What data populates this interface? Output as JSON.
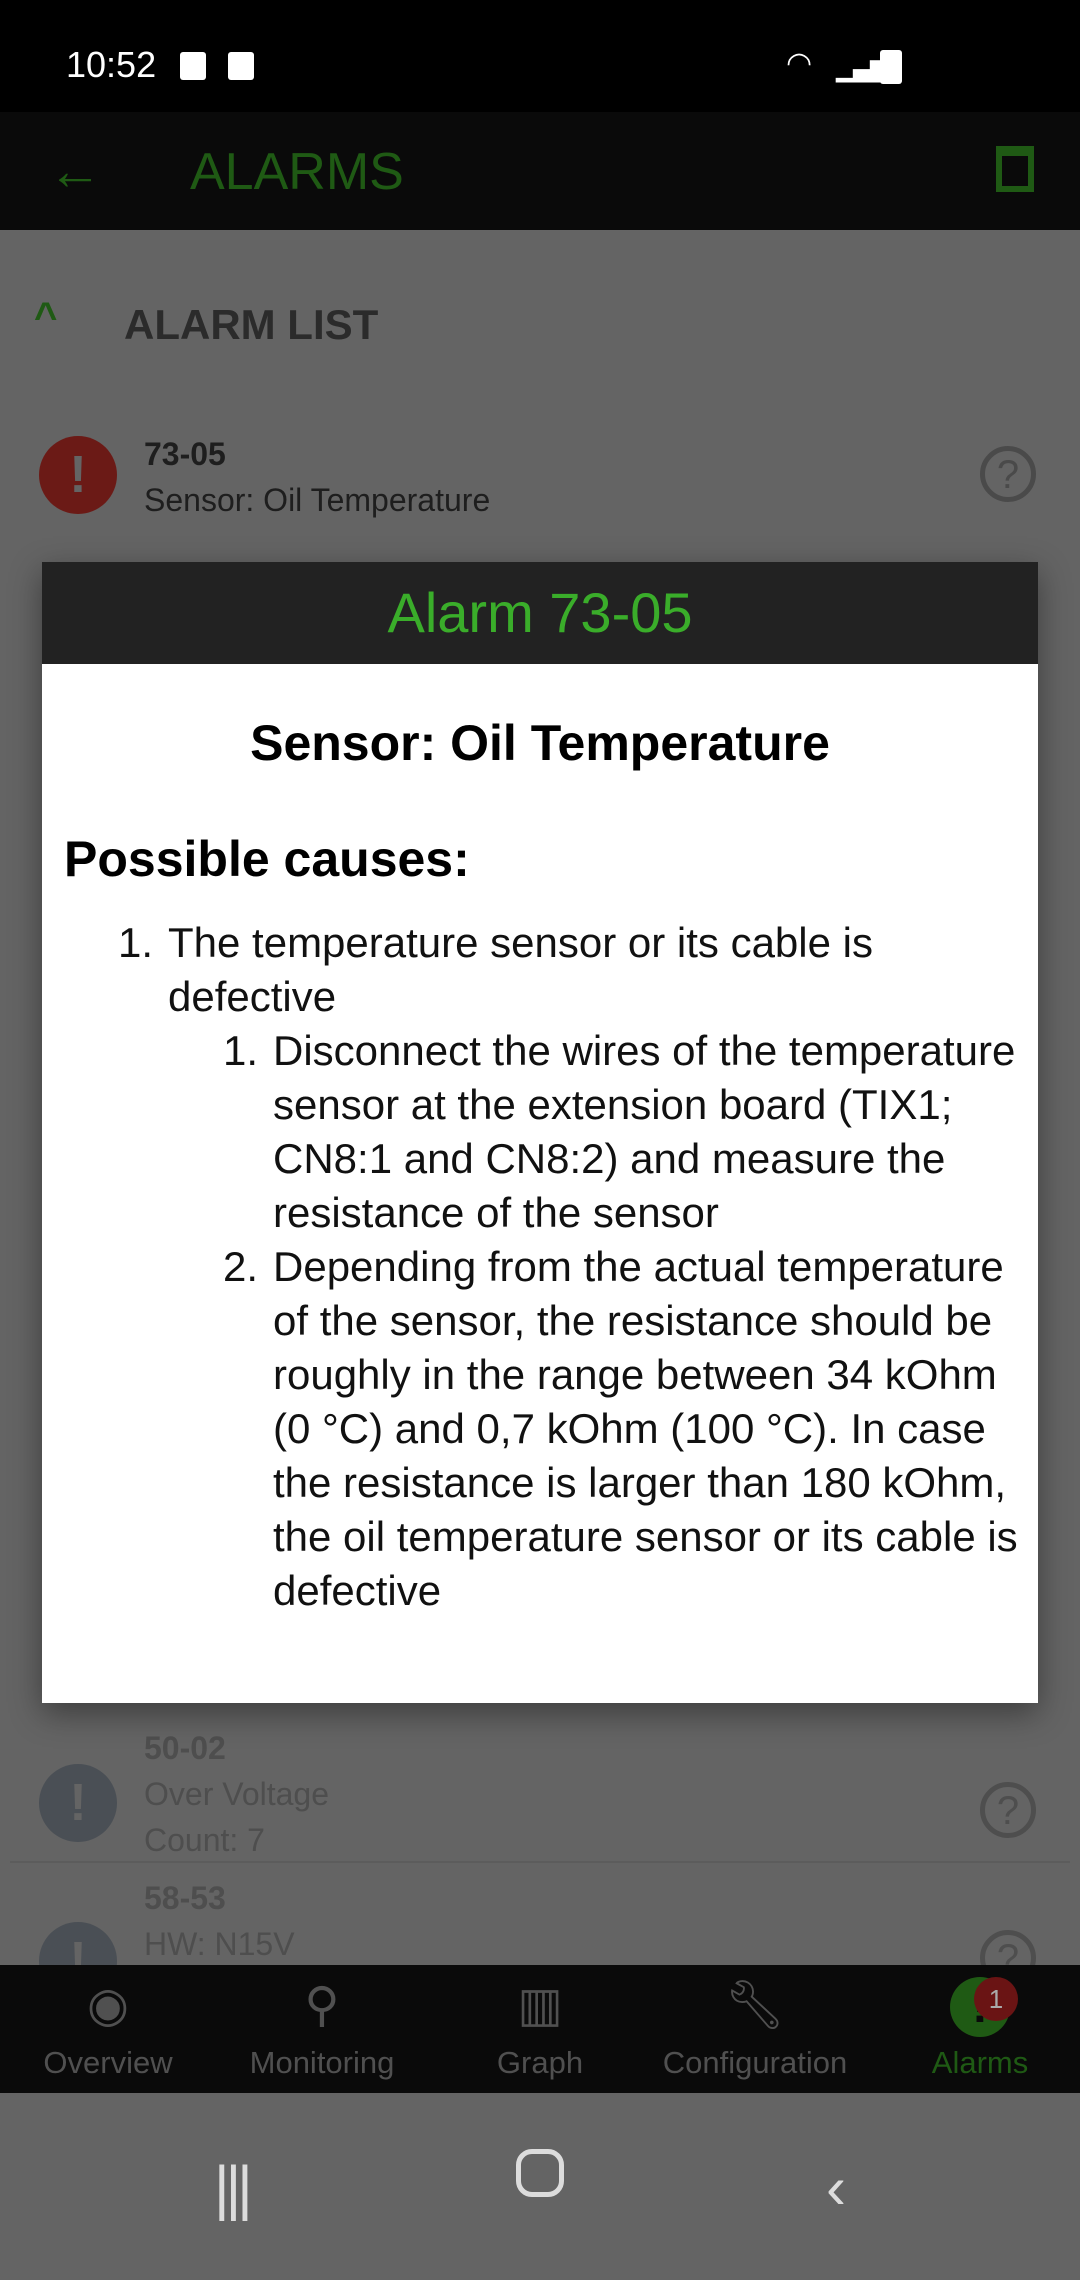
{
  "status_bar": {
    "time": "10:52",
    "icons": [
      "image-icon",
      "alarm-clock-icon",
      "wifi-icon",
      "signal-icon",
      "battery-icon"
    ]
  },
  "app_bar": {
    "title": "ALARMS",
    "back_icon": "arrow-left-icon",
    "action_icon": "trash-icon"
  },
  "section": {
    "label": "ALARM LIST"
  },
  "alarms": [
    {
      "code": "73-05",
      "text": "Sensor: Oil Temperature",
      "color": "#6b1a16"
    },
    {
      "code": "50-02",
      "text": "Over Voltage",
      "count": "Count: 7",
      "color": "#4a4f55"
    },
    {
      "code": "58-53",
      "text": "HW: N15V",
      "color": "#4a4f55"
    }
  ],
  "dialog": {
    "title": "Alarm 73-05",
    "subtitle": "Sensor: Oil Temperature",
    "causes_heading": "Possible causes:",
    "causes": [
      {
        "num": "1.",
        "text": "The temperature sensor or its cable is defective",
        "steps": [
          {
            "num": "1.",
            "text": "Disconnect the wires of the temperature sensor at the extension board (TIX1; CN8:1 and CN8:2) and measure the resistance of the sensor"
          },
          {
            "num": "2.",
            "text": "Depending from the actual temperature of the sensor, the resistance should be roughly in the range between 34 kOhm (0 °C) and 0,7 kOhm (100 °C). In case the resistance is larger than 180 kOhm, the oil temperature sensor or its cable is defective"
          }
        ]
      }
    ]
  },
  "bottom_nav": {
    "tabs": [
      {
        "label": "Overview",
        "icon": "eye-icon"
      },
      {
        "label": "Monitoring",
        "icon": "search-icon"
      },
      {
        "label": "Graph",
        "icon": "bar-chart-icon"
      },
      {
        "label": "Configuration",
        "icon": "wrench-icon"
      },
      {
        "label": "Alarms",
        "icon": "alert-icon",
        "badge": "1",
        "active": true
      }
    ]
  },
  "colors": {
    "accent": "#3aad2a",
    "dim_accent": "#1f5a14",
    "scrim": "#646464"
  }
}
